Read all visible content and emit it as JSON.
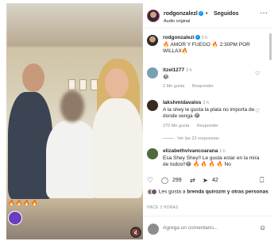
{
  "header": {
    "username": "rodgonzalezl",
    "follow_label": "Seguidos",
    "audio_label": "Audio original",
    "more_label": "···"
  },
  "media": {
    "emoji_overlay": "🔥🔥🔥🔥",
    "mute_icon": "🔇"
  },
  "caption": {
    "username": "rodgonzalezl",
    "time": "3 h",
    "text": "🔥 AMOR Y FUEGO 🔥 2:30PM POR WILLAX🔥"
  },
  "comments": [
    {
      "username": "itzel1277",
      "time": "3 h",
      "text": "😂",
      "likes": "2 Me gusta",
      "reply": "Responder"
    },
    {
      "username": "lakshmidavalos",
      "time": "3 h",
      "text": "A la shey le gusta la plata no importa de donde venga 😂",
      "likes": "275 Me gusta",
      "reply": "Responder",
      "replies": "Ver las 22 respuestas"
    },
    {
      "username": "elizabethvivancoarana",
      "time": "1 h",
      "text": "Esa Shey Shey!! Le gusta estar en la mira de todos!!😂 🔥 🔥 🔥 🔥 No"
    }
  ],
  "actions": {
    "like_count": "299",
    "share_count": "42"
  },
  "likes_line": {
    "prefix": "Les gusta a",
    "user": "brenda quirozm",
    "suffix": "y otras personas"
  },
  "time_ago": "HACE 3 HORAS",
  "add_comment": {
    "placeholder": "Agrega un comentario..."
  },
  "colors": {
    "verified": "#0095f6",
    "link": "#00376b",
    "muted": "#8e8e8e"
  }
}
